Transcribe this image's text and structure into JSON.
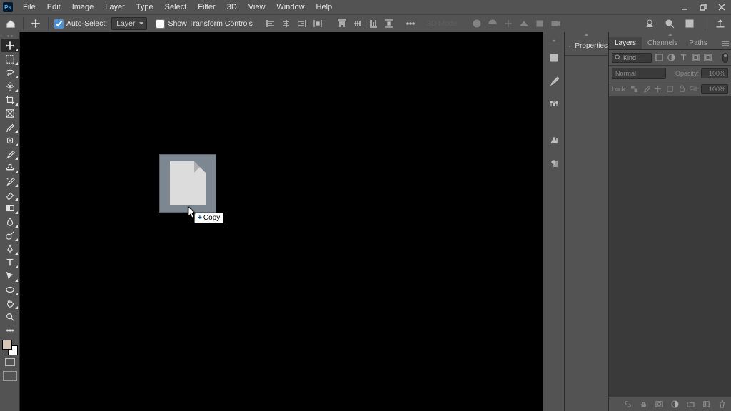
{
  "app": {
    "logo": "Ps"
  },
  "menu": {
    "items": [
      "File",
      "Edit",
      "Image",
      "Layer",
      "Type",
      "Select",
      "Filter",
      "3D",
      "View",
      "Window",
      "Help"
    ]
  },
  "optbar": {
    "auto_select_label": "Auto-Select:",
    "auto_select_checked": true,
    "auto_select_target": "Layer",
    "show_transform_label": "Show Transform Controls",
    "show_transform_checked": false,
    "mode3d_label": "3D Mode:"
  },
  "drag": {
    "tooltip_label": "Copy"
  },
  "props": {
    "title": "Properties"
  },
  "layers": {
    "tabs": {
      "layers": "Layers",
      "channels": "Channels",
      "paths": "Paths"
    },
    "kind_label": "Kind",
    "blend_mode": "Normal",
    "opacity_label": "Opacity:",
    "opacity_value": "100%",
    "lock_label": "Lock:",
    "fill_label": "Fill:",
    "fill_value": "100%"
  }
}
